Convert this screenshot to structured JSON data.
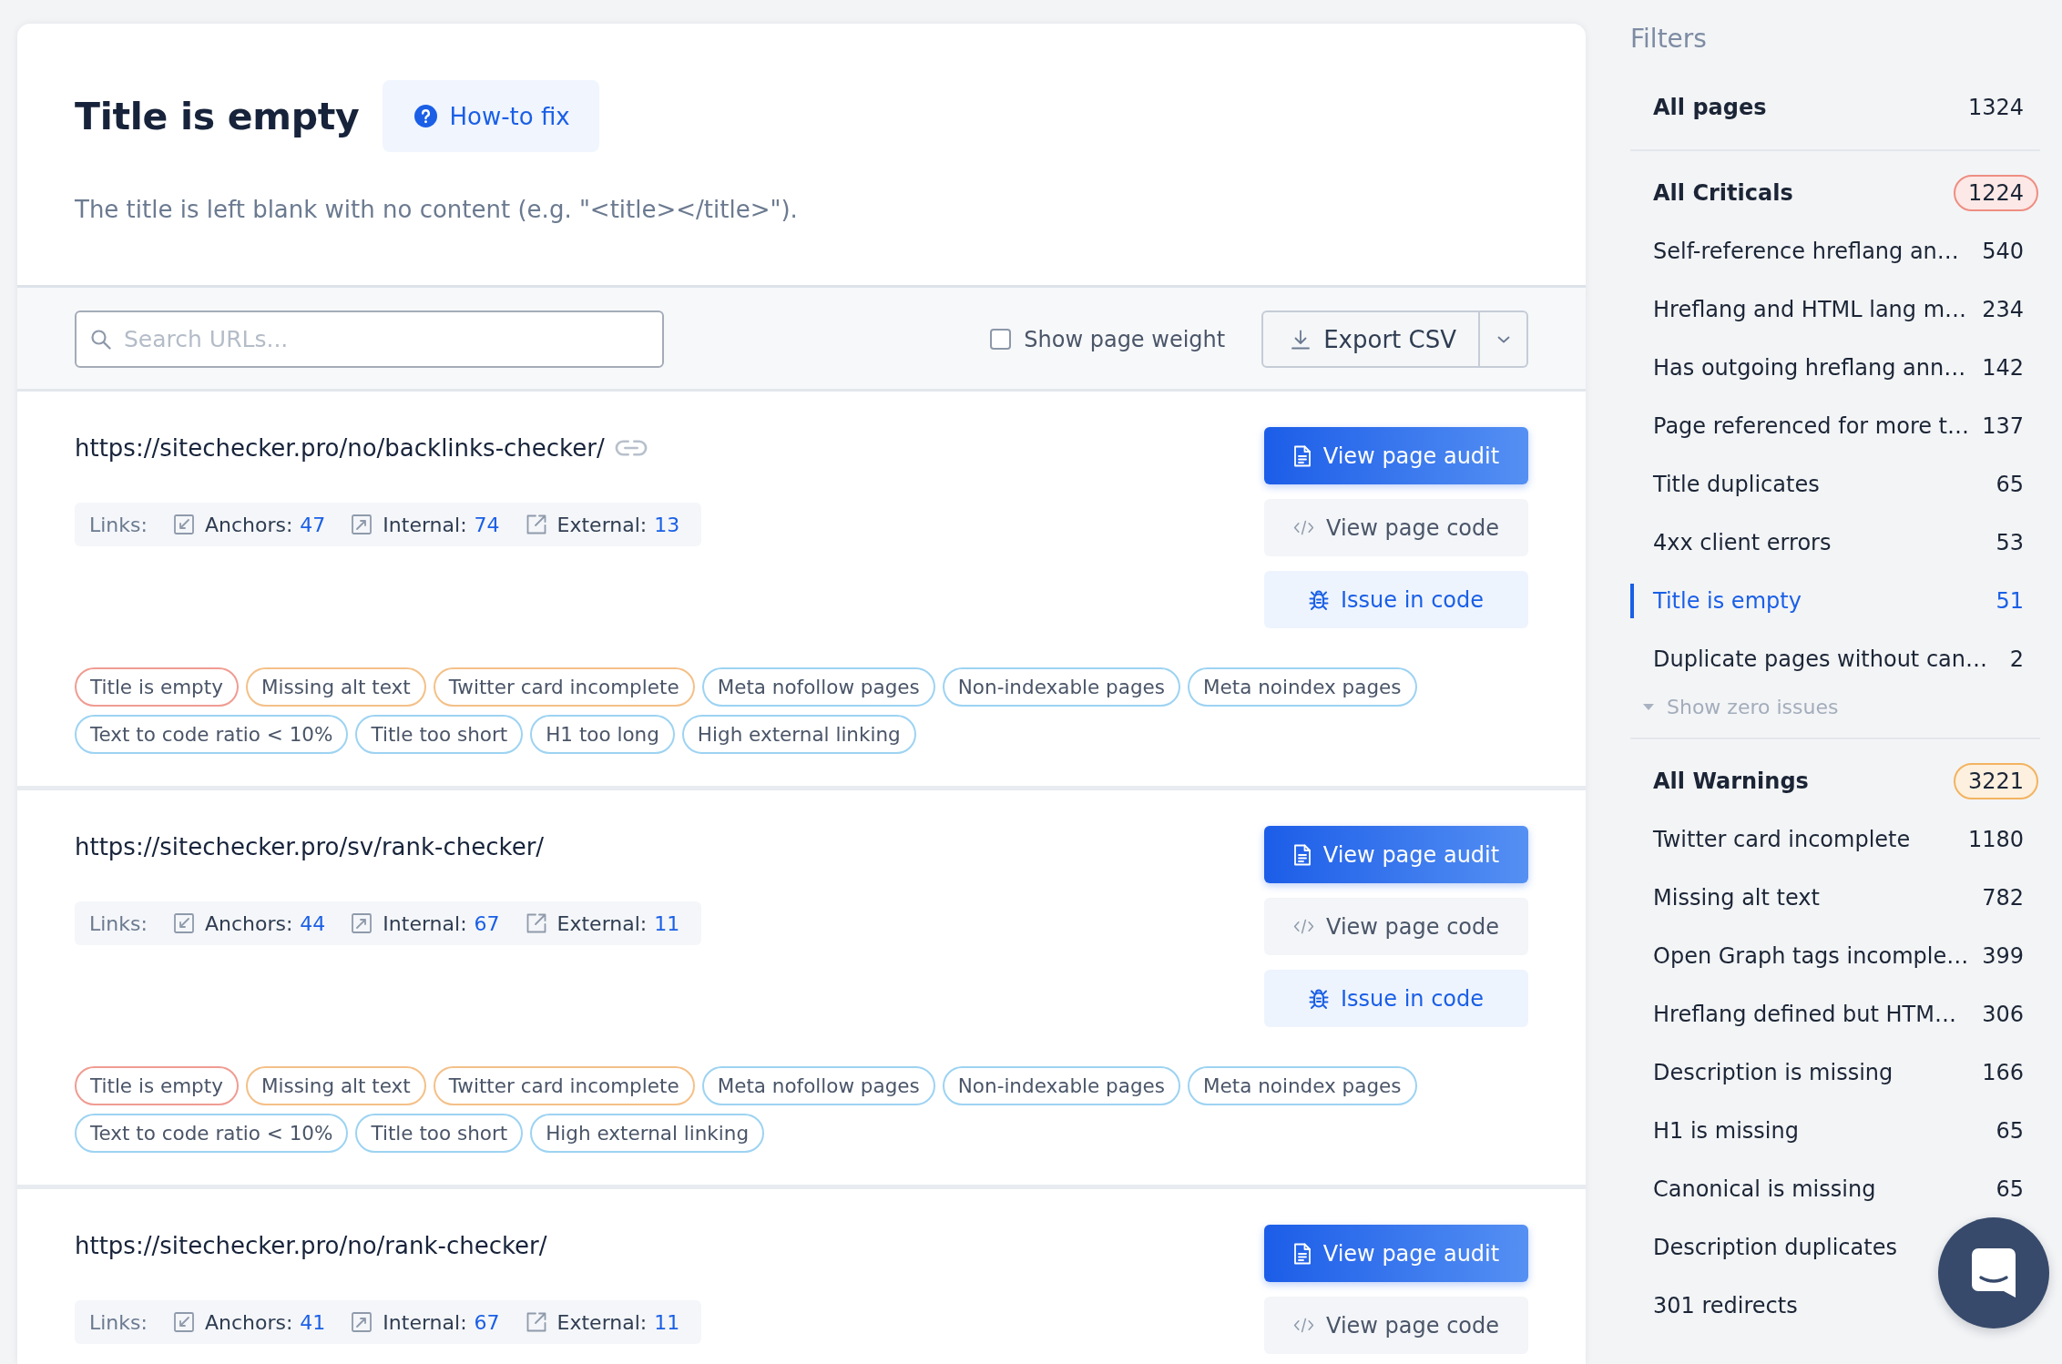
{
  "header": {
    "title": "Title is empty",
    "help_button": "How-to fix",
    "description": "The title is left blank with no content (e.g. \"<title></title>\")."
  },
  "toolbar": {
    "search": {
      "placeholder": "Search URLs..."
    },
    "page_weight": {
      "label": "Show page weight",
      "checked": false
    },
    "export": {
      "label": "Export CSV"
    }
  },
  "results": [
    {
      "url": "https://sitechecker.pro/no/backlinks-checker/",
      "link_icon": true,
      "links": {
        "label": "Links:",
        "stats": [
          {
            "kind": "anchors",
            "label": "Anchors:",
            "value": "47"
          },
          {
            "kind": "internal",
            "label": "Internal:",
            "value": "74"
          },
          {
            "kind": "external",
            "label": "External:",
            "value": "13"
          }
        ]
      },
      "buttons": [
        {
          "kind": "audit",
          "label": "View page audit"
        },
        {
          "kind": "code",
          "label": "View page code"
        },
        {
          "kind": "issue",
          "label": "Issue in code"
        }
      ],
      "tags": [
        {
          "label": "Title is empty",
          "color": "#f09c92"
        },
        {
          "label": "Missing alt text",
          "color": "#f4c088"
        },
        {
          "label": "Twitter card incomplete",
          "color": "#f4c088"
        },
        {
          "label": "Meta nofollow pages",
          "color": "#9dd3f2"
        },
        {
          "label": "Non-indexable pages",
          "color": "#9dd3f2"
        },
        {
          "label": "Meta noindex pages",
          "color": "#9dd3f2"
        },
        {
          "label": "Text to code ratio < 10%",
          "color": "#9dd3f2"
        },
        {
          "label": "Title too short",
          "color": "#9dd3f2"
        },
        {
          "label": "H1 too long",
          "color": "#9dd3f2"
        },
        {
          "label": "High external linking",
          "color": "#9dd3f2"
        }
      ]
    },
    {
      "url": "https://sitechecker.pro/sv/rank-checker/",
      "link_icon": false,
      "links": {
        "label": "Links:",
        "stats": [
          {
            "kind": "anchors",
            "label": "Anchors:",
            "value": "44"
          },
          {
            "kind": "internal",
            "label": "Internal:",
            "value": "67"
          },
          {
            "kind": "external",
            "label": "External:",
            "value": "11"
          }
        ]
      },
      "buttons": [
        {
          "kind": "audit",
          "label": "View page audit"
        },
        {
          "kind": "code",
          "label": "View page code"
        },
        {
          "kind": "issue",
          "label": "Issue in code"
        }
      ],
      "tags": [
        {
          "label": "Title is empty",
          "color": "#f09c92"
        },
        {
          "label": "Missing alt text",
          "color": "#f4c088"
        },
        {
          "label": "Twitter card incomplete",
          "color": "#f4c088"
        },
        {
          "label": "Meta nofollow pages",
          "color": "#9dd3f2"
        },
        {
          "label": "Non-indexable pages",
          "color": "#9dd3f2"
        },
        {
          "label": "Meta noindex pages",
          "color": "#9dd3f2"
        },
        {
          "label": "Text to code ratio < 10%",
          "color": "#9dd3f2"
        },
        {
          "label": "Title too short",
          "color": "#9dd3f2"
        },
        {
          "label": "High external linking",
          "color": "#9dd3f2"
        }
      ]
    },
    {
      "url": "https://sitechecker.pro/no/rank-checker/",
      "link_icon": false,
      "links": {
        "label": "Links:",
        "stats": [
          {
            "kind": "anchors",
            "label": "Anchors:",
            "value": "41"
          },
          {
            "kind": "internal",
            "label": "Internal:",
            "value": "67"
          },
          {
            "kind": "external",
            "label": "External:",
            "value": "11"
          }
        ]
      },
      "buttons": [
        {
          "kind": "audit",
          "label": "View page audit"
        },
        {
          "kind": "code",
          "label": "View page code"
        }
      ]
    }
  ],
  "sidebar": {
    "title": "Filters",
    "all_pages": {
      "label": "All pages",
      "count": "1324",
      "selected": false
    },
    "groups": [
      {
        "label": "All Criticals",
        "count": "1224",
        "color": "#ee8e82",
        "selected": false,
        "items": [
          {
            "label": "Self-reference hreflang an…",
            "count": "540",
            "selected": false
          },
          {
            "label": "Hreflang and HTML lang m…",
            "count": "234",
            "selected": false
          },
          {
            "label": "Has outgoing hreflang ann…",
            "count": "142",
            "selected": false
          },
          {
            "label": "Page referenced for more t…",
            "count": "137",
            "selected": false
          },
          {
            "label": "Title duplicates",
            "count": "65",
            "selected": false
          },
          {
            "label": "4xx client errors",
            "count": "53",
            "selected": false
          },
          {
            "label": "Title is empty",
            "count": "51",
            "selected": true
          },
          {
            "label": "Duplicate pages without can…",
            "count": "2",
            "selected": false
          }
        ],
        "toggle": "Show zero issues"
      },
      {
        "label": "All Warnings",
        "count": "3221",
        "color": "#f3b35f",
        "selected": false,
        "items": [
          {
            "label": "Twitter card incomplete",
            "count": "1180",
            "selected": false
          },
          {
            "label": "Missing alt text",
            "count": "782",
            "selected": false
          },
          {
            "label": "Open Graph tags incomple…",
            "count": "399",
            "selected": false
          },
          {
            "label": "Hreflang defined but HTM…",
            "count": "306",
            "selected": false
          },
          {
            "label": "Description is missing",
            "count": "166",
            "selected": false
          },
          {
            "label": "H1 is missing",
            "count": "65",
            "selected": false
          },
          {
            "label": "Canonical is missing",
            "count": "65",
            "selected": false
          },
          {
            "label": "Description duplicates",
            "selected": false
          },
          {
            "label": "301 redirects",
            "selected": false
          }
        ]
      }
    ]
  }
}
